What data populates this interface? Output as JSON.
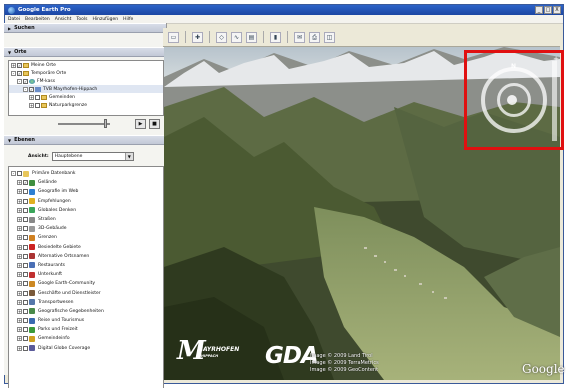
{
  "window": {
    "title": "Google Earth Pro",
    "controls": [
      "_",
      "□",
      "X"
    ]
  },
  "menu": [
    "Datei",
    "Bearbeiten",
    "Ansicht",
    "Tools",
    "Hinzufügen",
    "Hilfe"
  ],
  "panels": {
    "search": "Suchen",
    "places": "Orte",
    "layers": "Ebenen"
  },
  "places_tree": [
    {
      "label": "Meine Orte",
      "exp": "+",
      "checked": true,
      "icon": "folder",
      "indent": 0
    },
    {
      "label": "Temporäre Orte",
      "exp": "-",
      "checked": true,
      "icon": "folder",
      "indent": 0
    },
    {
      "label": "FM-kass",
      "exp": "-",
      "checked": true,
      "icon": "globe",
      "indent": 1
    },
    {
      "label": "TVB Mayrhofen-Hippach",
      "exp": "-",
      "checked": true,
      "icon": "tour",
      "indent": 2,
      "selected": true
    },
    {
      "label": "Gemeinden",
      "exp": "+",
      "checked": false,
      "icon": "folder",
      "indent": 3
    },
    {
      "label": "Naturparkgrenze",
      "exp": "+",
      "checked": false,
      "icon": "folder",
      "indent": 3
    }
  ],
  "tour_buttons": {
    "play": "▶",
    "stop": "■"
  },
  "view": {
    "label": "Ansicht:",
    "value": "Hauptebene"
  },
  "layers_tree": [
    {
      "label": "Primäre Datenbank",
      "color": "#e8c65a",
      "checked": false
    },
    {
      "label": "Gelände",
      "color": "#3f8f3f",
      "checked": true
    },
    {
      "label": "Geografie im Web",
      "color": "#2e7fd1",
      "checked": false
    },
    {
      "label": "Empfehlungen",
      "color": "#e0b020",
      "checked": false
    },
    {
      "label": "Globales Denken",
      "color": "#3aa55a",
      "checked": false
    },
    {
      "label": "Straßen",
      "color": "#888888",
      "checked": false
    },
    {
      "label": "3D-Gebäude",
      "color": "#999999",
      "checked": false
    },
    {
      "label": "Grenzen",
      "color": "#d08020",
      "checked": false
    },
    {
      "label": "Besiedelte Gebiete",
      "color": "#cc2222",
      "checked": false
    },
    {
      "label": "Alternative Ortsnamen",
      "color": "#aa3333",
      "checked": false
    },
    {
      "label": "Restaurants",
      "color": "#4a6fb5",
      "checked": false
    },
    {
      "label": "Unterkunft",
      "color": "#c03030",
      "checked": false
    },
    {
      "label": "Google Earth-Community",
      "color": "#cc8822",
      "checked": false
    },
    {
      "label": "Geschäfte und Dienstleister",
      "color": "#7a5a3a",
      "checked": false
    },
    {
      "label": "Transportwesen",
      "color": "#5577aa",
      "checked": false
    },
    {
      "label": "Geografische Gegebenheiten",
      "color": "#4a8a4a",
      "checked": false
    },
    {
      "label": "Reise und Tourismus",
      "color": "#3a6ab0",
      "checked": false
    },
    {
      "label": "Parks und Freizeit",
      "color": "#3a9a3a",
      "checked": false
    },
    {
      "label": "Gemeindeinfo",
      "color": "#d0a020",
      "checked": false
    },
    {
      "label": "Digital Globe Coverage",
      "color": "#5a5a9a",
      "checked": false
    }
  ],
  "toolbar_icons": [
    "sidebar-toggle-icon",
    "placemark-icon",
    "polygon-icon",
    "path-icon",
    "overlay-icon",
    "ruler-icon",
    "email-icon",
    "print-icon",
    "maps-icon"
  ],
  "overlay": {
    "north": "N",
    "zoom_plus": "+"
  },
  "logos": {
    "mayrhofen_m": "M",
    "mayrhofen_text": "MAYRHOFEN",
    "mayrhofen_sub": "HIPPACH",
    "gda": "GDA",
    "google": "Google"
  },
  "copyright": [
    "Image © 2009 Land Tirol",
    "Image © 2009 TerraMetrics",
    "Image © 2009 GeoContent"
  ]
}
